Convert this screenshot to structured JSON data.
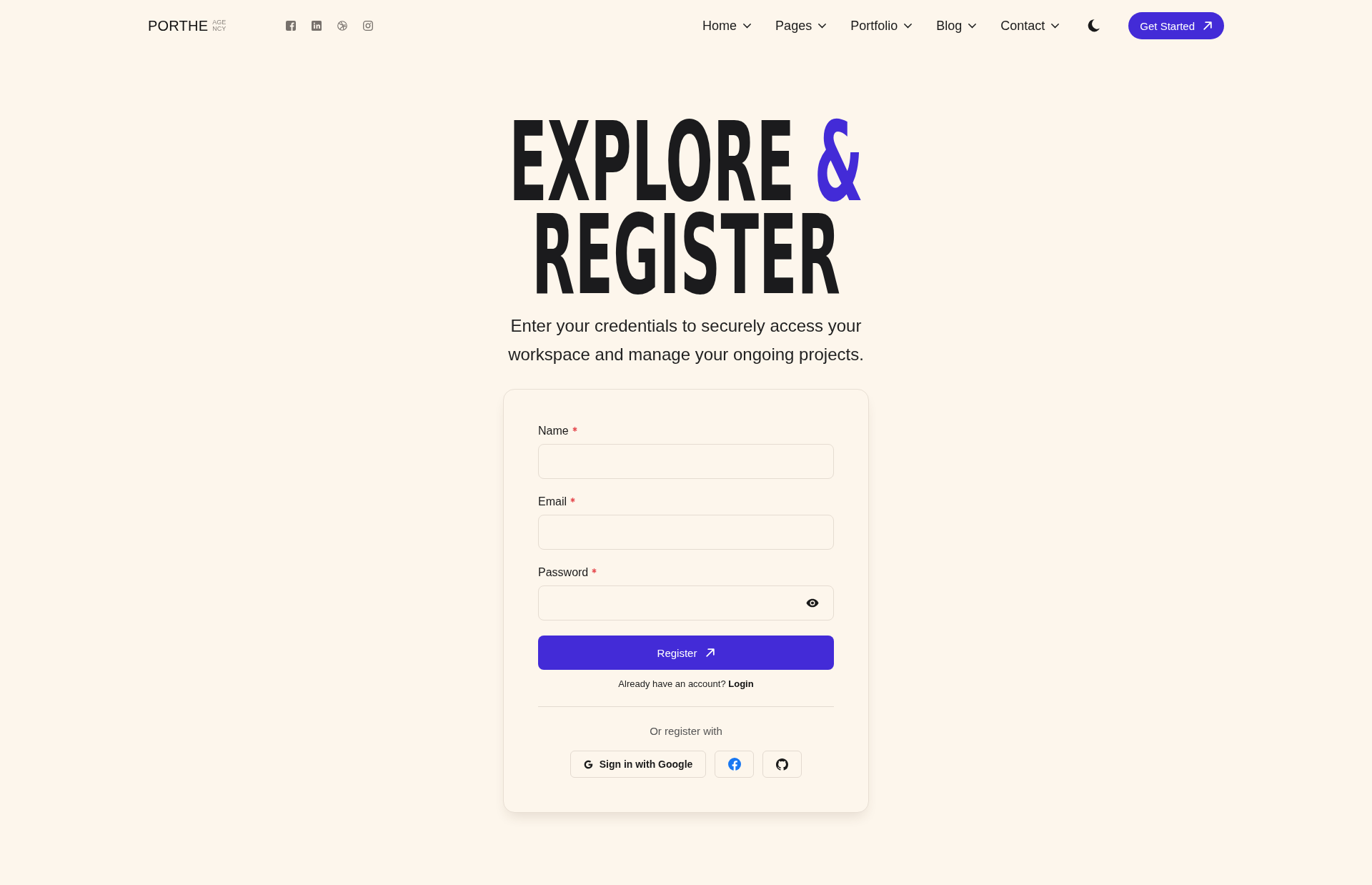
{
  "header": {
    "logo": {
      "wordmark": "PORTHE",
      "tagline": [
        "AGE",
        "NCY"
      ]
    },
    "nav": [
      {
        "label": "Home",
        "has_dropdown": true
      },
      {
        "label": "Pages",
        "has_dropdown": true
      },
      {
        "label": "Portfolio",
        "has_dropdown": true
      },
      {
        "label": "Blog",
        "has_dropdown": true
      },
      {
        "label": "Contact",
        "has_dropdown": true
      }
    ],
    "cta": {
      "label": "Get Started"
    }
  },
  "hero": {
    "heading": [
      [
        {
          "text": "EXPLORE",
          "accent": false
        },
        {
          "text": "&",
          "accent": true
        }
      ],
      [
        {
          "text": "REGISTER",
          "accent": false
        }
      ]
    ],
    "subtitle": "Enter your credentials to securely access your workspace and manage your ongoing projects."
  },
  "form": {
    "fields": [
      {
        "label": "Name",
        "kind": "text",
        "required": true
      },
      {
        "label": "Email",
        "kind": "email",
        "required": true
      },
      {
        "label": "Password",
        "kind": "password",
        "required": true
      }
    ],
    "submit": {
      "label": "Register"
    },
    "login_prompt": {
      "text": "Already have an account?",
      "link": "Login"
    },
    "alt_heading": "Or register with",
    "google_button": {
      "label": "Sign in with Google"
    }
  }
}
